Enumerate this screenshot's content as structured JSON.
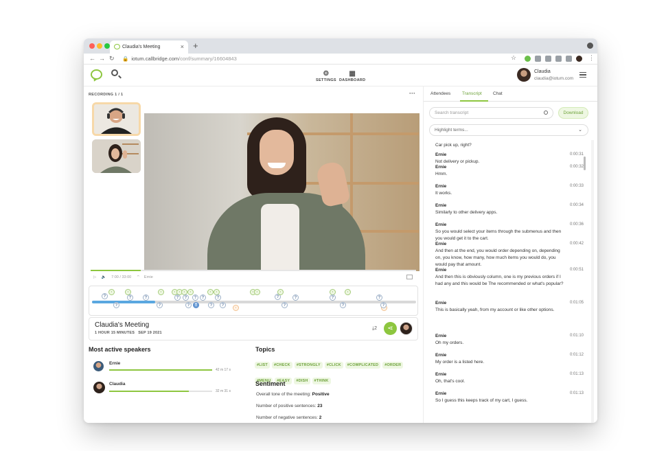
{
  "browser": {
    "tab_title": "Claudia's Meeting",
    "tab_close": "×",
    "new_tab": "+",
    "url_domain": "iotum.callbridge.com",
    "url_path": "/conf/summary/16604843"
  },
  "header": {
    "settings_label": "SETTINGS",
    "dashboard_label": "DASHBOARD",
    "user_name": "Claudia",
    "user_email": "claudia@iotum.com"
  },
  "recording": {
    "label": "RECORDING 1 / 1",
    "more": "···",
    "progress_fraction": 0.155
  },
  "player": {
    "time": "7:00 / 33:00",
    "speaker": "Ernie"
  },
  "timeline": {
    "progress_fraction": 0.195
  },
  "meeting": {
    "title": "Claudia's Meeting",
    "duration": "1 HOUR 15 MINUTES",
    "date": "SEP 19 2021",
    "downloads": "2"
  },
  "speakers": {
    "heading": "Most active speakers",
    "items": [
      {
        "name": "Ernie",
        "time": "42 m 17 s",
        "fraction": 1.0
      },
      {
        "name": "Claudia",
        "time": "32 m 31 s",
        "fraction": 0.77
      }
    ]
  },
  "topics": {
    "heading": "Topics",
    "tags": [
      "#LIST",
      "#CHECK",
      "#STRONGLY",
      "#CLICK",
      "#COMPLICATED",
      "#ORDER",
      "#MENU",
      "#EASY",
      "#DISH",
      "#THINK"
    ]
  },
  "sentiment": {
    "heading": "Sentiment",
    "overall_label": "Overall tone of the meeting:",
    "overall_value": "Positive",
    "positive_label": "Number of positive sentences:",
    "positive_value": "23",
    "negative_label": "Number of negative sentences:",
    "negative_value": "2"
  },
  "side": {
    "tabs": [
      "Attendees",
      "Transcript",
      "Chat"
    ],
    "search_placeholder": "Search transcript",
    "download": "Download",
    "highlight": "Highlight terms...",
    "first_line": "Car pick up, right?",
    "entries": [
      {
        "speaker": "Ernie",
        "time": "0:00:31",
        "text": "Not delivery or pickup."
      },
      {
        "speaker": "Ernie",
        "time": "0:00:32",
        "text": "Hmm."
      },
      {
        "speaker": "Ernie",
        "time": "0:00:33",
        "text": "It works."
      },
      {
        "speaker": "Ernie",
        "time": "0:00:34",
        "text": "Similarly to other delivery apps."
      },
      {
        "speaker": "Ernie",
        "time": "0:00:36",
        "text": "So you would select your items through the submenus and then you would get it to the cart."
      },
      {
        "speaker": "Ernie",
        "time": "0:00:42",
        "text": "And then at the end, you would order depending on, depending on, you know, how many, how much items you would do, you would pay that amount."
      },
      {
        "speaker": "Ernie",
        "time": "0:00:51",
        "text": "And then this is obviously column, one is my previous orders if I had any and this would be The recommended or what's popular?"
      },
      {
        "speaker": "Ernie",
        "time": "0:01:05",
        "text": "This is basically yeah, from my account or like other options."
      },
      {
        "speaker": "Ernie",
        "time": "0:01:10",
        "text": "Oh my orders."
      },
      {
        "speaker": "Ernie",
        "time": "0:01:12",
        "text": "My order is a listed here."
      },
      {
        "speaker": "Ernie",
        "time": "0:01:13",
        "text": "Oh, that's cool."
      },
      {
        "speaker": "Ernie",
        "time": "0:01:13",
        "text": "So I guess this keeps track of my cart, I guess."
      }
    ]
  },
  "colors": {
    "accent": "#8dc63f",
    "timeline_blue": "#5aa7e0"
  }
}
